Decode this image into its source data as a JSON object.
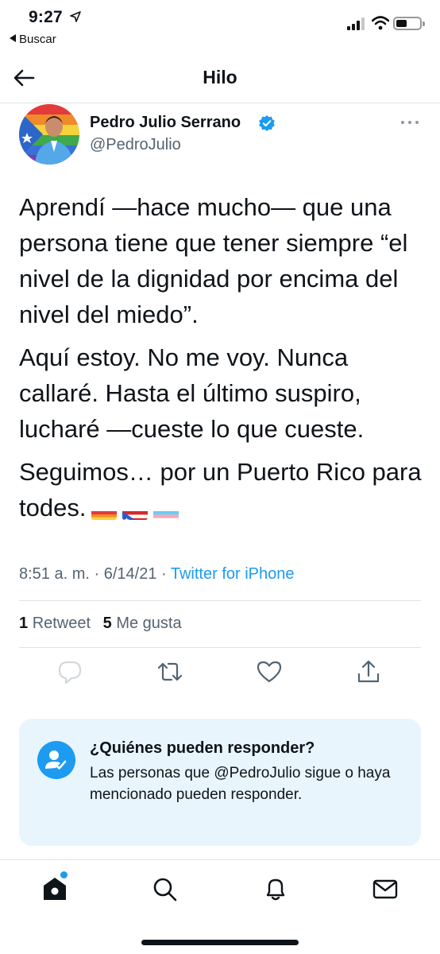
{
  "status_bar": {
    "time": "9:27",
    "back_app_label": "Buscar"
  },
  "header": {
    "title": "Hilo"
  },
  "tweet": {
    "author_name": "Pedro Julio Serrano",
    "handle": "@PedroJulio",
    "paragraphs": [
      "Aprendí —hace mucho— que una persona tiene que tener siempre “el nivel de la dignidad por encima del nivel del miedo”.",
      "Aquí estoy. No me voy. Nunca callaré. Hasta el último suspiro, lucharé —cueste lo que cueste.",
      "Seguimos… por un Puerto Rico para todes."
    ],
    "emoji_flags": [
      "rainbow-flag",
      "puerto-rico-flag",
      "transgender-flag"
    ],
    "time": "8:51 a. m.",
    "date": "6/14/21",
    "source": "Twitter for iPhone",
    "retweet_count": "1",
    "retweet_label": "Retweet",
    "like_count": "5",
    "like_label": "Me gusta"
  },
  "reply_card": {
    "title": "¿Quiénes pueden responder?",
    "description": "Las personas que @PedroJulio sigue o haya mencionado pueden responder."
  },
  "actions": [
    "reply-icon",
    "retweet-icon",
    "like-icon",
    "share-icon"
  ],
  "tab_bar": [
    "home-icon",
    "search-icon",
    "notifications-icon",
    "messages-icon"
  ],
  "colors": {
    "accent": "#1d9bf0",
    "text": "#0f1419",
    "secondary_text": "#536471",
    "card_bg": "#e8f5fd"
  }
}
